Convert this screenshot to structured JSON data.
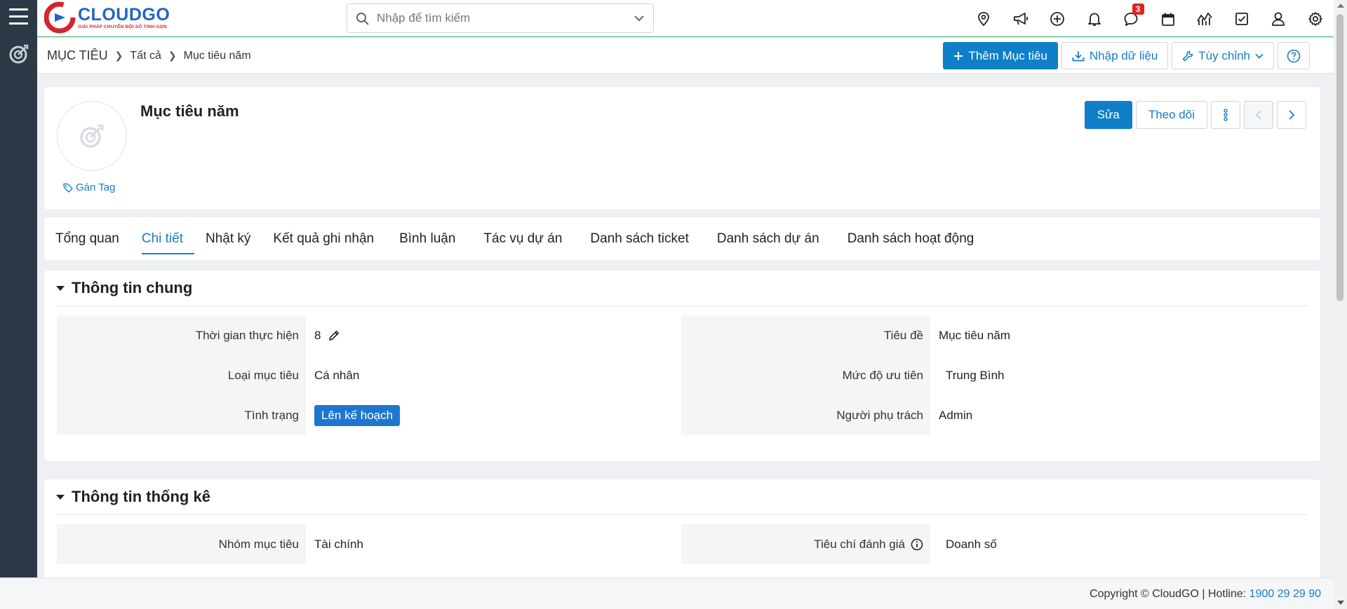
{
  "colors": {
    "primary": "#0e7fc8",
    "rail": "#2c3a47",
    "accent_line": "#38b26a",
    "badge": "#e02424"
  },
  "logo": {
    "brand": "CLOUDGO",
    "slogan": "GIẢI PHÁP CHUYỂN ĐỔI SỐ TINH GỌN"
  },
  "search": {
    "placeholder": "Nhập để tìm kiếm"
  },
  "top_icons": [
    "map-pin-icon",
    "megaphone-icon",
    "plus-circle-icon",
    "bell-icon",
    "chat-icon",
    "calendar-icon",
    "chart-icon",
    "checkbox-icon",
    "user-icon",
    "gear-icon"
  ],
  "chat_badge": "3",
  "breadcrumb": {
    "root": "MỤC TIÊU",
    "level1": "Tất cả",
    "level2": "Mục tiêu năm"
  },
  "actions": {
    "add": "Thêm Mục tiêu",
    "import": "Nhập dữ liệu",
    "customize": "Tùy chỉnh"
  },
  "record": {
    "title": "Mục tiêu năm",
    "tag_label": "Gán Tag",
    "edit": "Sửa",
    "follow": "Theo dõi"
  },
  "tabs": [
    "Tổng quan",
    "Chi tiết",
    "Nhật ký",
    "Kết quả ghi nhận",
    "Bình luận",
    "Tác vụ dự án",
    "Danh sách ticket",
    "Danh sách dự án",
    "Danh sách hoạt động"
  ],
  "active_tab": "Chi tiết",
  "general": {
    "title": "Thông tin chung",
    "left": [
      {
        "label": "Thời gian thực hiện",
        "value": "8"
      },
      {
        "label": "Loại mục tiêu",
        "value": "Cá nhân"
      },
      {
        "label": "Tình trạng",
        "value": "Lên kế hoạch"
      }
    ],
    "right": [
      {
        "label": "Tiêu đề",
        "value": "Mục tiêu năm"
      },
      {
        "label": "Mức độ ưu tiên",
        "value": "Trung Bình"
      },
      {
        "label": "Người phụ trách",
        "value": "Admin"
      }
    ]
  },
  "stats": {
    "title": "Thông tin thống kê",
    "left": [
      {
        "label": "Nhóm mục tiêu",
        "value": "Tài chính"
      }
    ],
    "right": [
      {
        "label": "Tiêu chí đánh giá",
        "value": "Doanh số"
      }
    ]
  },
  "footer": {
    "copyright": "Copyright © CloudGO",
    "hotline_label": "Hotline:",
    "hotline": "1900 29 29 90"
  }
}
